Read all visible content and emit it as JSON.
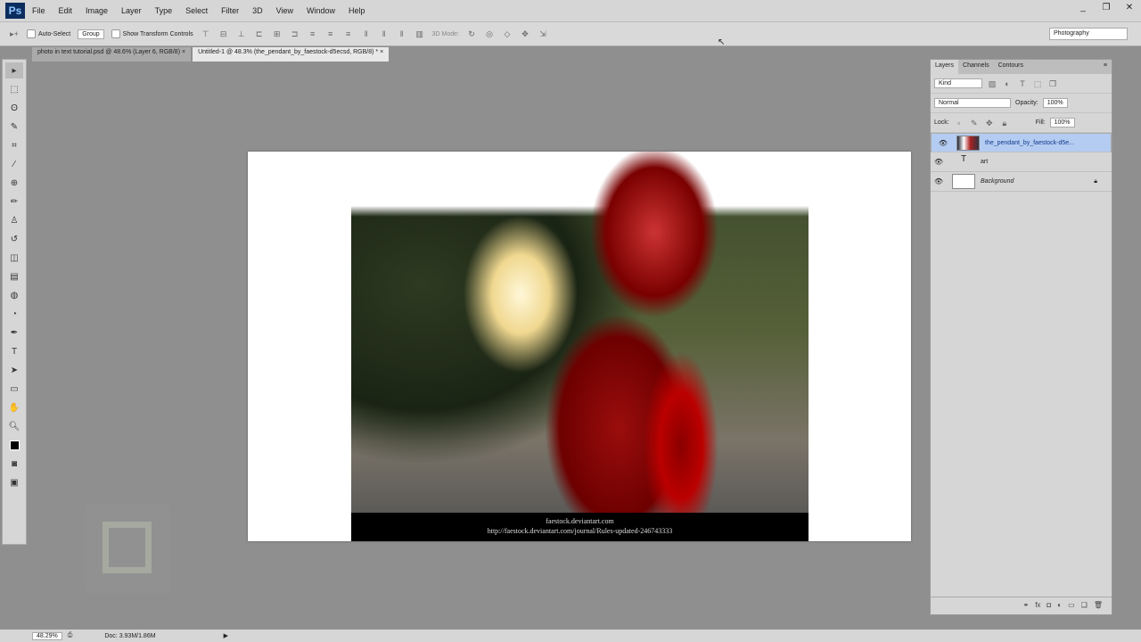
{
  "app": {
    "logo": "Ps",
    "menu": [
      "File",
      "Edit",
      "Image",
      "Layer",
      "Type",
      "Select",
      "Filter",
      "3D",
      "View",
      "Window",
      "Help"
    ],
    "window_buttons": [
      "_",
      "❐",
      "✕"
    ]
  },
  "options": {
    "auto_select": "Auto-Select",
    "group": "Group",
    "show_transform": "Show Transform Controls",
    "mode_3d": "3D Mode:",
    "workspace": "Photography"
  },
  "tabs": [
    {
      "label": "photo in text tutorial.psd @ 48.6% (Layer 6, RGB/8)",
      "close": "×"
    },
    {
      "label": "Untitled-1 @ 48.3% (the_pendant_by_faestock-d5ecsd, RGB/8) *",
      "close": "×"
    }
  ],
  "document": {
    "caption_line1": "faestock.deviantart.com",
    "caption_line2": "http://faestock.deviantart.com/journal/Rules-updated-246743333"
  },
  "layers_panel": {
    "tabs": [
      "Layers",
      "Channels",
      "Contours"
    ],
    "filter_kind": "Kind",
    "blend_mode": "Normal",
    "opacity_label": "Opacity:",
    "opacity": "100%",
    "lock_label": "Lock:",
    "fill_label": "Fill:",
    "fill": "100%",
    "layers": [
      {
        "name": "the_pendant_by_faestock-d5e...",
        "type": "image",
        "selected": true
      },
      {
        "name": "art",
        "type": "text",
        "selected": false
      },
      {
        "name": "Background",
        "type": "background",
        "selected": false,
        "locked": true
      }
    ]
  },
  "status": {
    "zoom": "48.29%",
    "doc_info": "Doc: 3.93M/1.86M"
  }
}
